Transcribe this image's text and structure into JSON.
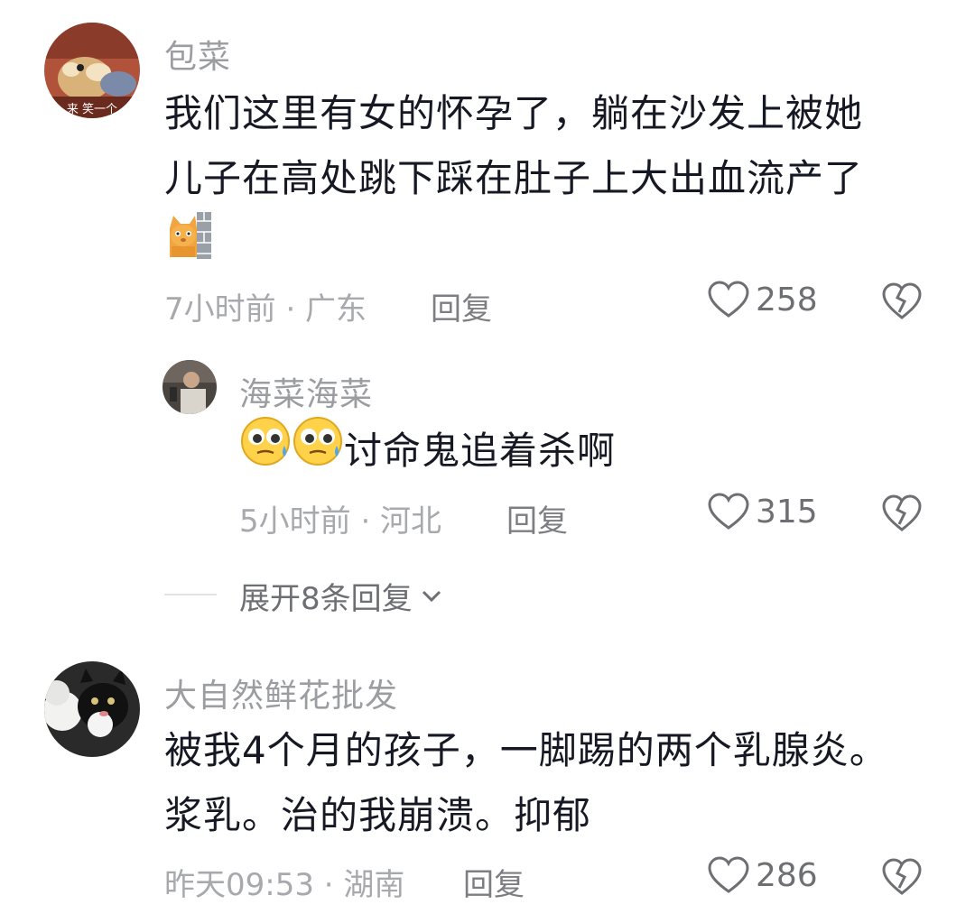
{
  "comments": [
    {
      "username": "包菜",
      "avatar_caption": "来 笑一个",
      "text_lines": [
        "我们这里有女的怀孕了，躺在沙发上被她",
        "儿子在高处跳下踩在肚子上大出血流产了"
      ],
      "sticker": "cat-peeking-wall-sticker",
      "meta": "7小时前 · 广东",
      "reply_label": "回复",
      "likes": "258",
      "reply": {
        "username": "海菜海菜",
        "emoji": "pleading-tear-face-emoji",
        "text": "讨命鬼追着杀啊",
        "meta": "5小时前 · 河北",
        "reply_label": "回复",
        "likes": "315"
      },
      "expand_label": "展开8条回复"
    },
    {
      "username": "大自然鲜花批发",
      "text_lines": [
        "被我4个月的孩子，一脚踢的两个乳腺炎。",
        "浆乳。治的我崩溃。抑郁"
      ],
      "meta": "昨天09:53 · 湖南",
      "reply_label": "回复",
      "likes": "286"
    }
  ],
  "icons": {
    "like": "heart-outline-icon",
    "dislike": "broken-heart-icon",
    "expand": "chevron-down-icon"
  },
  "colors": {
    "username": "#9c9da1",
    "text": "#161823",
    "meta": "#a8a9ad"
  }
}
